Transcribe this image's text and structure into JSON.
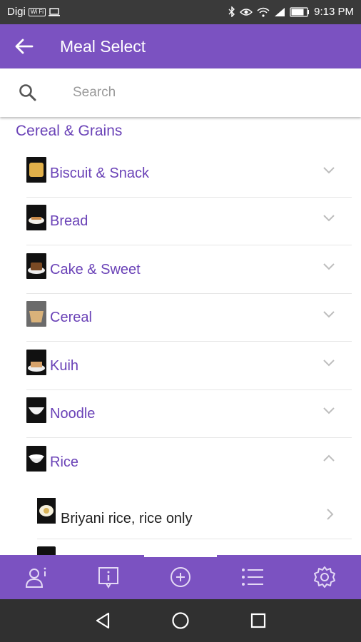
{
  "status_bar": {
    "carrier": "Digi",
    "carrier_badge": "Wi Fi",
    "time": "9:13 PM",
    "battery": "80",
    "icons": [
      "laptop-icon",
      "bluetooth-icon",
      "eye-icon",
      "wifi-icon",
      "signal-icon",
      "battery-icon"
    ]
  },
  "app_bar": {
    "title": "Meal Select",
    "back_icon": "arrow-left-icon",
    "color": "#7b52c1"
  },
  "search": {
    "placeholder": "Search",
    "value": "",
    "icon": "search-icon"
  },
  "section": {
    "title": "Cereal & Grains",
    "color": "#6a42b7"
  },
  "categories": [
    {
      "label": "Biscuit & Snack",
      "expanded": false
    },
    {
      "label": "Bread",
      "expanded": false
    },
    {
      "label": "Cake & Sweet",
      "expanded": false
    },
    {
      "label": "Cereal",
      "expanded": false
    },
    {
      "label": "Kuih",
      "expanded": false
    },
    {
      "label": "Noodle",
      "expanded": false
    },
    {
      "label": "Rice",
      "expanded": true
    }
  ],
  "rice_items": [
    {
      "label": "Briyani rice, rice only"
    }
  ],
  "bottom_nav": {
    "items": [
      "profile-info-icon",
      "info-icon",
      "add-circle-icon",
      "list-icon",
      "settings-icon"
    ],
    "active_index": 2
  },
  "system_nav": {
    "items": [
      "back-triangle-icon",
      "home-circle-icon",
      "recents-square-icon"
    ]
  }
}
